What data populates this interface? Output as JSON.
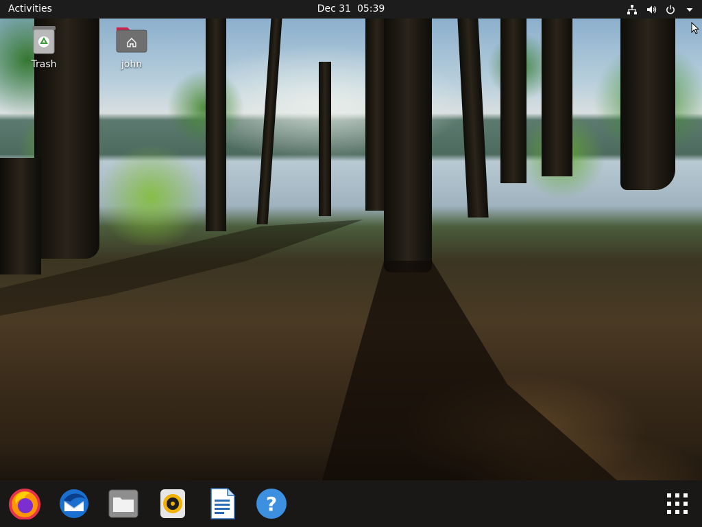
{
  "topbar": {
    "activities_label": "Activities",
    "clock": "Dec 31  05:39",
    "status_icons": [
      "network-icon",
      "volume-icon",
      "power-icon",
      "menu-arrow-icon"
    ]
  },
  "desktop": {
    "icons": [
      {
        "label": "Trash",
        "icon": "trash-icon"
      },
      {
        "label": "john",
        "icon": "home-folder-icon"
      }
    ]
  },
  "dock": {
    "apps": [
      {
        "name": "firefox",
        "icon": "firefox-icon"
      },
      {
        "name": "thunderbird",
        "icon": "thunderbird-icon"
      },
      {
        "name": "files",
        "icon": "files-icon"
      },
      {
        "name": "rhythmbox",
        "icon": "rhythmbox-icon"
      },
      {
        "name": "libreoffice-writer",
        "icon": "writer-icon"
      },
      {
        "name": "help",
        "icon": "help-icon"
      }
    ],
    "show_apps_icon": "app-grid-icon"
  },
  "colors": {
    "topbar_bg": "#1c1c1c",
    "dock_bg": "#191919",
    "folder_accent": "#c7254e",
    "help_blue": "#3d8fe0"
  }
}
